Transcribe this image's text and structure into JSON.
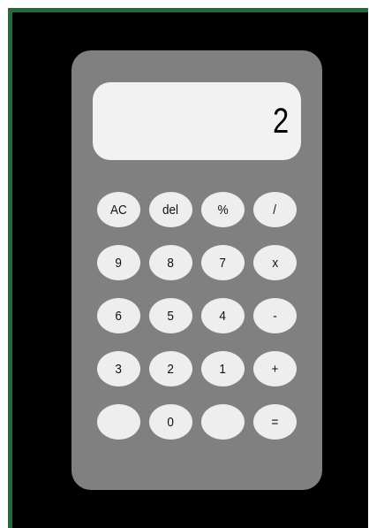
{
  "calculator": {
    "display": "2",
    "keys": [
      {
        "label": "AC"
      },
      {
        "label": "del"
      },
      {
        "label": "%"
      },
      {
        "label": "/"
      },
      {
        "label": "9"
      },
      {
        "label": "8"
      },
      {
        "label": "7"
      },
      {
        "label": "x"
      },
      {
        "label": "6"
      },
      {
        "label": "5"
      },
      {
        "label": "4"
      },
      {
        "label": "-"
      },
      {
        "label": "3"
      },
      {
        "label": "2"
      },
      {
        "label": "1"
      },
      {
        "label": "+"
      },
      {
        "label": ""
      },
      {
        "label": "0"
      },
      {
        "label": ""
      },
      {
        "label": "="
      }
    ]
  },
  "colors": {
    "frame_border": "#1f6b3a",
    "page_background": "#000000",
    "body": "#808080",
    "display_background": "#f2f2f2",
    "key_background": "#eeeeee"
  }
}
